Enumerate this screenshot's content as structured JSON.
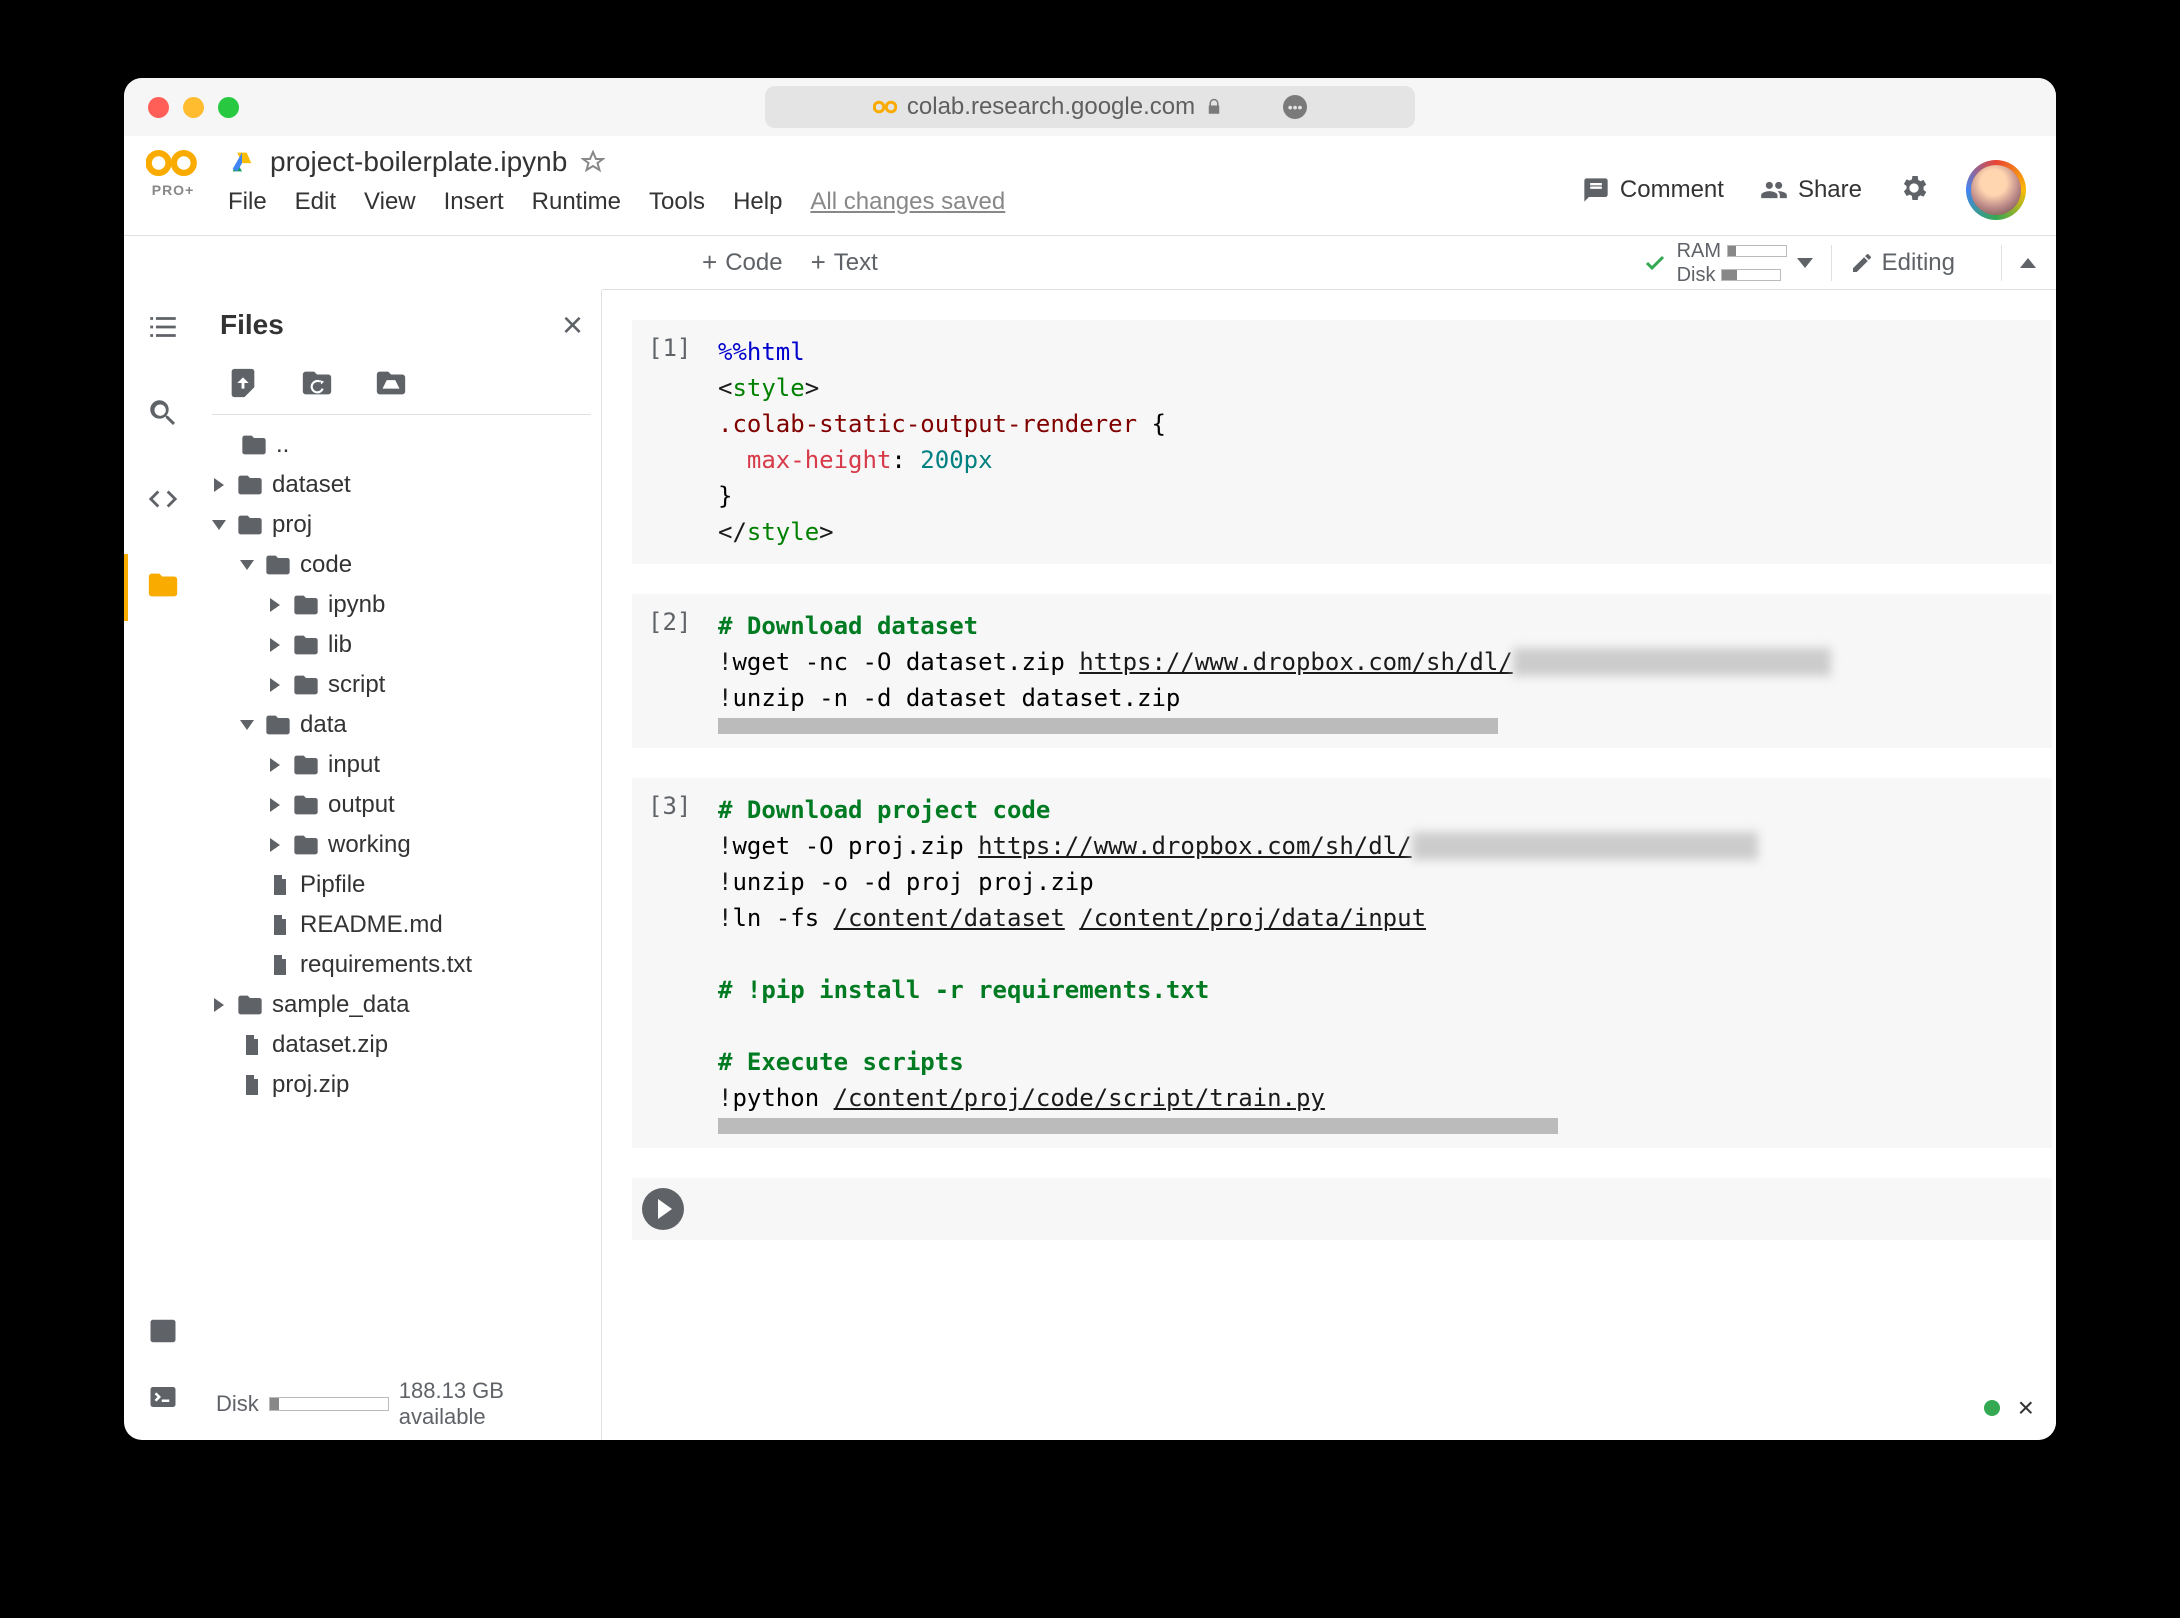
{
  "url": "colab.research.google.com",
  "header": {
    "title": "project-boilerplate.ipynb",
    "logo_sub": "PRO+",
    "menu": [
      "File",
      "Edit",
      "View",
      "Insert",
      "Runtime",
      "Tools",
      "Help"
    ],
    "saved": "All changes saved",
    "comment": "Comment",
    "share": "Share"
  },
  "toolbar": {
    "code": "Code",
    "text": "Text",
    "ram": "RAM",
    "disk": "Disk",
    "editing": "Editing"
  },
  "files": {
    "title": "Files",
    "disk_label": "Disk",
    "disk_avail": "188.13 GB available",
    "tree": {
      "updir": "..",
      "dataset": "dataset",
      "proj": "proj",
      "code": "code",
      "ipynb": "ipynb",
      "lib": "lib",
      "script": "script",
      "data": "data",
      "input": "input",
      "output": "output",
      "working": "working",
      "pipfile": "Pipfile",
      "readme": "README.md",
      "requirements": "requirements.txt",
      "sample_data": "sample_data",
      "dataset_zip": "dataset.zip",
      "proj_zip": "proj.zip"
    }
  },
  "cells": {
    "c1_num": "[1]",
    "c1_l1_a": "%%",
    "c1_l1_b": "html",
    "c1_l2_a": "<",
    "c1_l2_b": "style",
    "c1_l2_c": ">",
    "c1_l3": ".colab-static-output-renderer ",
    "c1_l3_b": "{",
    "c1_l4_a": "  max-height",
    "c1_l4_b": ": ",
    "c1_l4_c": "200px",
    "c1_l5": "}",
    "c1_l6_a": "</",
    "c1_l6_b": "style",
    "c1_l6_c": ">",
    "c2_num": "[2]",
    "c2_l1": "# Download dataset",
    "c2_l2_a": "!",
    "c2_l2_b": "wget -nc -O dataset.zip ",
    "c2_l2_c": "https://www.dropbox.com/sh/dl/",
    "c2_l2_d": "xxxxxxxxxxxxxxxxxxxxxx",
    "c2_l3_a": "!",
    "c2_l3_b": "unzip -n -d dataset dataset.zip",
    "c3_num": "[3]",
    "c3_l1": "# Download project code",
    "c3_l2_a": "!",
    "c3_l2_b": "wget -O proj.zip ",
    "c3_l2_c": "https://www.dropbox.com/sh/dl/",
    "c3_l2_d": "xxxxxxxxxxxxxxxxxxxxxxxx",
    "c3_l3_a": "!",
    "c3_l3_b": "unzip -o -d proj proj.zip",
    "c3_l4_a": "!",
    "c3_l4_b": "ln -fs ",
    "c3_l4_c": "/content/dataset",
    "c3_l4_d": " ",
    "c3_l4_e": "/content/proj/data/input",
    "c3_l6": "# !pip install -r requirements.txt",
    "c3_l8": "# Execute scripts",
    "c3_l9_a": "!",
    "c3_l9_b": "python ",
    "c3_l9_c": "/content/proj/code/script/train.py"
  }
}
